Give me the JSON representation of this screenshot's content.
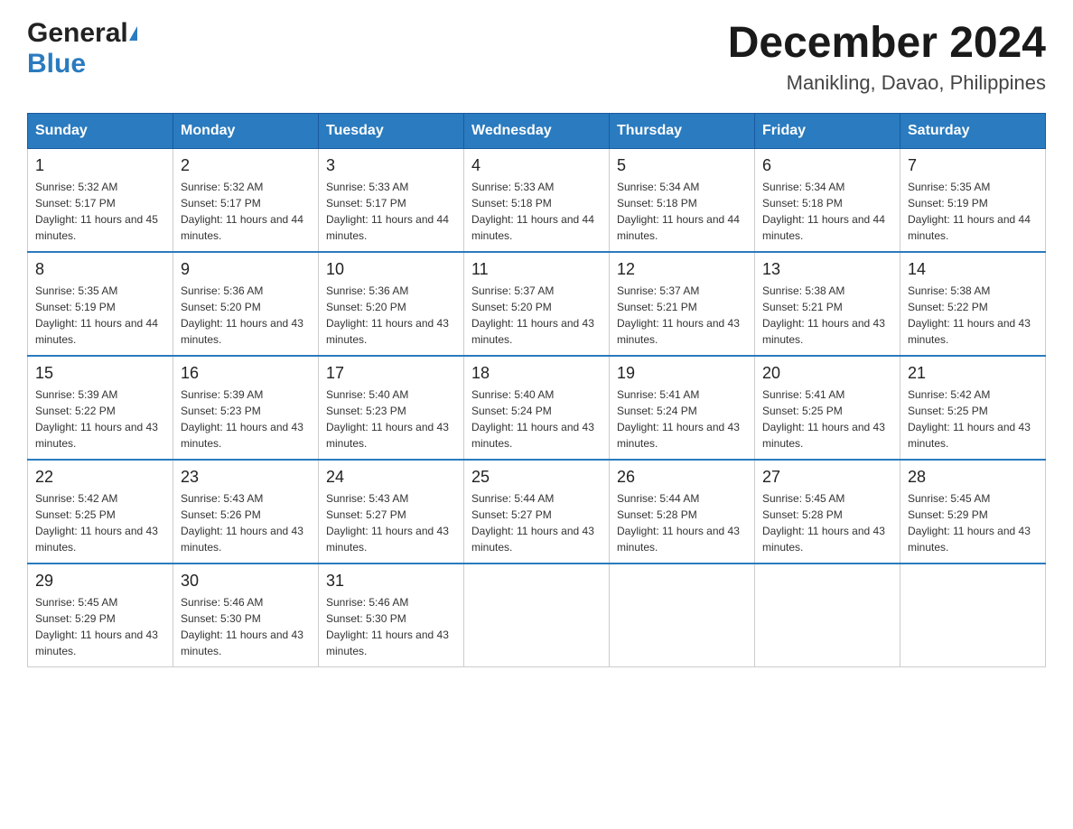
{
  "logo": {
    "general": "General",
    "blue": "Blue"
  },
  "title": {
    "month_year": "December 2024",
    "location": "Manikling, Davao, Philippines"
  },
  "days_of_week": [
    "Sunday",
    "Monday",
    "Tuesday",
    "Wednesday",
    "Thursday",
    "Friday",
    "Saturday"
  ],
  "weeks": [
    [
      {
        "day": "1",
        "sunrise": "Sunrise: 5:32 AM",
        "sunset": "Sunset: 5:17 PM",
        "daylight": "Daylight: 11 hours and 45 minutes."
      },
      {
        "day": "2",
        "sunrise": "Sunrise: 5:32 AM",
        "sunset": "Sunset: 5:17 PM",
        "daylight": "Daylight: 11 hours and 44 minutes."
      },
      {
        "day": "3",
        "sunrise": "Sunrise: 5:33 AM",
        "sunset": "Sunset: 5:17 PM",
        "daylight": "Daylight: 11 hours and 44 minutes."
      },
      {
        "day": "4",
        "sunrise": "Sunrise: 5:33 AM",
        "sunset": "Sunset: 5:18 PM",
        "daylight": "Daylight: 11 hours and 44 minutes."
      },
      {
        "day": "5",
        "sunrise": "Sunrise: 5:34 AM",
        "sunset": "Sunset: 5:18 PM",
        "daylight": "Daylight: 11 hours and 44 minutes."
      },
      {
        "day": "6",
        "sunrise": "Sunrise: 5:34 AM",
        "sunset": "Sunset: 5:18 PM",
        "daylight": "Daylight: 11 hours and 44 minutes."
      },
      {
        "day": "7",
        "sunrise": "Sunrise: 5:35 AM",
        "sunset": "Sunset: 5:19 PM",
        "daylight": "Daylight: 11 hours and 44 minutes."
      }
    ],
    [
      {
        "day": "8",
        "sunrise": "Sunrise: 5:35 AM",
        "sunset": "Sunset: 5:19 PM",
        "daylight": "Daylight: 11 hours and 44 minutes."
      },
      {
        "day": "9",
        "sunrise": "Sunrise: 5:36 AM",
        "sunset": "Sunset: 5:20 PM",
        "daylight": "Daylight: 11 hours and 43 minutes."
      },
      {
        "day": "10",
        "sunrise": "Sunrise: 5:36 AM",
        "sunset": "Sunset: 5:20 PM",
        "daylight": "Daylight: 11 hours and 43 minutes."
      },
      {
        "day": "11",
        "sunrise": "Sunrise: 5:37 AM",
        "sunset": "Sunset: 5:20 PM",
        "daylight": "Daylight: 11 hours and 43 minutes."
      },
      {
        "day": "12",
        "sunrise": "Sunrise: 5:37 AM",
        "sunset": "Sunset: 5:21 PM",
        "daylight": "Daylight: 11 hours and 43 minutes."
      },
      {
        "day": "13",
        "sunrise": "Sunrise: 5:38 AM",
        "sunset": "Sunset: 5:21 PM",
        "daylight": "Daylight: 11 hours and 43 minutes."
      },
      {
        "day": "14",
        "sunrise": "Sunrise: 5:38 AM",
        "sunset": "Sunset: 5:22 PM",
        "daylight": "Daylight: 11 hours and 43 minutes."
      }
    ],
    [
      {
        "day": "15",
        "sunrise": "Sunrise: 5:39 AM",
        "sunset": "Sunset: 5:22 PM",
        "daylight": "Daylight: 11 hours and 43 minutes."
      },
      {
        "day": "16",
        "sunrise": "Sunrise: 5:39 AM",
        "sunset": "Sunset: 5:23 PM",
        "daylight": "Daylight: 11 hours and 43 minutes."
      },
      {
        "day": "17",
        "sunrise": "Sunrise: 5:40 AM",
        "sunset": "Sunset: 5:23 PM",
        "daylight": "Daylight: 11 hours and 43 minutes."
      },
      {
        "day": "18",
        "sunrise": "Sunrise: 5:40 AM",
        "sunset": "Sunset: 5:24 PM",
        "daylight": "Daylight: 11 hours and 43 minutes."
      },
      {
        "day": "19",
        "sunrise": "Sunrise: 5:41 AM",
        "sunset": "Sunset: 5:24 PM",
        "daylight": "Daylight: 11 hours and 43 minutes."
      },
      {
        "day": "20",
        "sunrise": "Sunrise: 5:41 AM",
        "sunset": "Sunset: 5:25 PM",
        "daylight": "Daylight: 11 hours and 43 minutes."
      },
      {
        "day": "21",
        "sunrise": "Sunrise: 5:42 AM",
        "sunset": "Sunset: 5:25 PM",
        "daylight": "Daylight: 11 hours and 43 minutes."
      }
    ],
    [
      {
        "day": "22",
        "sunrise": "Sunrise: 5:42 AM",
        "sunset": "Sunset: 5:25 PM",
        "daylight": "Daylight: 11 hours and 43 minutes."
      },
      {
        "day": "23",
        "sunrise": "Sunrise: 5:43 AM",
        "sunset": "Sunset: 5:26 PM",
        "daylight": "Daylight: 11 hours and 43 minutes."
      },
      {
        "day": "24",
        "sunrise": "Sunrise: 5:43 AM",
        "sunset": "Sunset: 5:27 PM",
        "daylight": "Daylight: 11 hours and 43 minutes."
      },
      {
        "day": "25",
        "sunrise": "Sunrise: 5:44 AM",
        "sunset": "Sunset: 5:27 PM",
        "daylight": "Daylight: 11 hours and 43 minutes."
      },
      {
        "day": "26",
        "sunrise": "Sunrise: 5:44 AM",
        "sunset": "Sunset: 5:28 PM",
        "daylight": "Daylight: 11 hours and 43 minutes."
      },
      {
        "day": "27",
        "sunrise": "Sunrise: 5:45 AM",
        "sunset": "Sunset: 5:28 PM",
        "daylight": "Daylight: 11 hours and 43 minutes."
      },
      {
        "day": "28",
        "sunrise": "Sunrise: 5:45 AM",
        "sunset": "Sunset: 5:29 PM",
        "daylight": "Daylight: 11 hours and 43 minutes."
      }
    ],
    [
      {
        "day": "29",
        "sunrise": "Sunrise: 5:45 AM",
        "sunset": "Sunset: 5:29 PM",
        "daylight": "Daylight: 11 hours and 43 minutes."
      },
      {
        "day": "30",
        "sunrise": "Sunrise: 5:46 AM",
        "sunset": "Sunset: 5:30 PM",
        "daylight": "Daylight: 11 hours and 43 minutes."
      },
      {
        "day": "31",
        "sunrise": "Sunrise: 5:46 AM",
        "sunset": "Sunset: 5:30 PM",
        "daylight": "Daylight: 11 hours and 43 minutes."
      },
      null,
      null,
      null,
      null
    ]
  ]
}
